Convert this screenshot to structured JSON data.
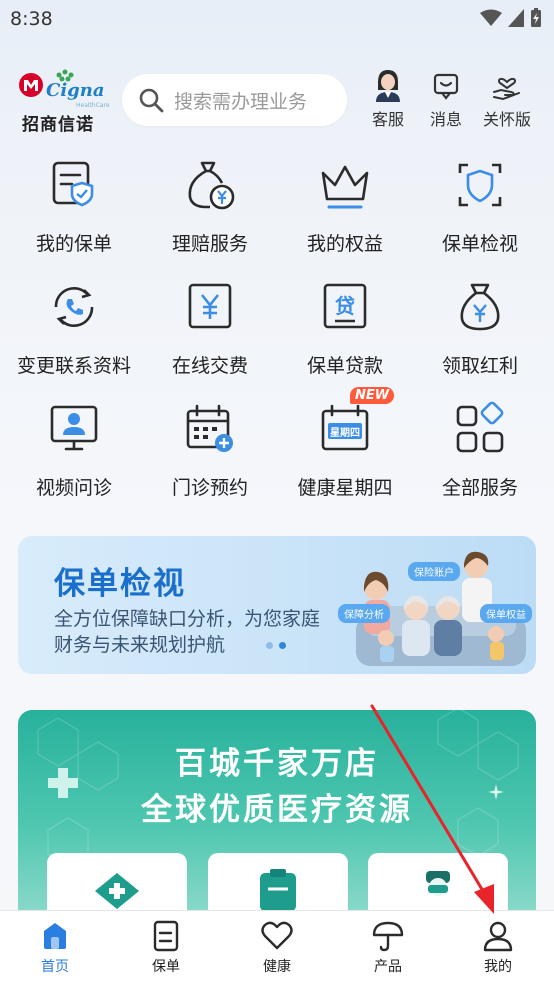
{
  "status_bar": {
    "time": "8:38"
  },
  "header": {
    "logo_brand": "Cigna",
    "logo_brand_sub": "HealthCare",
    "logo_cn": "招商信诺",
    "search_placeholder": "搜索需办理业务",
    "service_label": "客服",
    "message_label": "消息",
    "care_label": "关怀版"
  },
  "services": [
    {
      "label": "我的保单",
      "icon": "policy-icon"
    },
    {
      "label": "理赔服务",
      "icon": "claim-icon"
    },
    {
      "label": "我的权益",
      "icon": "crown-icon"
    },
    {
      "label": "保单检视",
      "icon": "shield-icon"
    },
    {
      "label": "变更联系资料",
      "icon": "phone-icon"
    },
    {
      "label": "在线交费",
      "icon": "yuan-icon"
    },
    {
      "label": "保单贷款",
      "icon": "loan-icon"
    },
    {
      "label": "领取红利",
      "icon": "moneybag-icon"
    },
    {
      "label": "视频问诊",
      "icon": "video-doctor-icon"
    },
    {
      "label": "门诊预约",
      "icon": "calendar-icon"
    },
    {
      "label": "健康星期四",
      "icon": "thursday-icon",
      "badge": "NEW",
      "inner": "星期四"
    },
    {
      "label": "全部服务",
      "icon": "all-services-icon"
    }
  ],
  "banner_review": {
    "title": "保单检视",
    "subtitle": "全方位保障缺口分析，为您家庭财务与未来规划护航",
    "tag_account": "保险账户",
    "tag_analysis": "保障分析",
    "tag_rights": "保单权益"
  },
  "banner_medical": {
    "line1": "百城千家万店",
    "line2": "全球优质医疗资源"
  },
  "tabs": [
    {
      "label": "首页",
      "icon": "home-icon",
      "active": true
    },
    {
      "label": "保单",
      "icon": "document-icon",
      "active": false
    },
    {
      "label": "健康",
      "icon": "heart-icon",
      "active": false
    },
    {
      "label": "产品",
      "icon": "umbrella-icon",
      "active": false
    },
    {
      "label": "我的",
      "icon": "person-icon",
      "active": false
    }
  ],
  "colors": {
    "accent": "#2a7de1",
    "brand_red": "#d6002a",
    "teal": "#27b19c",
    "annotation_arrow": "#e8232a"
  }
}
